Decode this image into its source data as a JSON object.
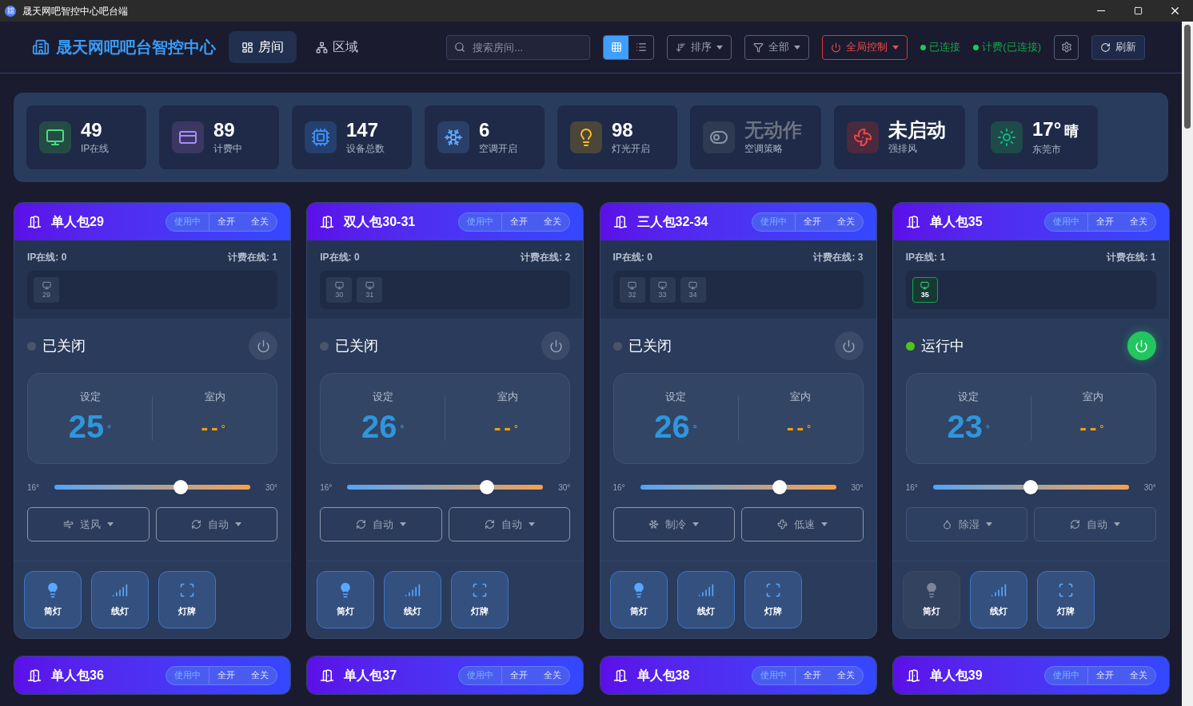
{
  "window": {
    "title": "晟天网吧智控中心吧台端"
  },
  "header": {
    "app_title": "晟天网吧吧台智控中心",
    "tabs": [
      {
        "label": "房间",
        "kind": "grid",
        "selected": true
      },
      {
        "label": "区域",
        "kind": "tree",
        "selected": false
      }
    ],
    "search": {
      "placeholder": "搜索房间..."
    },
    "view_modes": [
      {
        "kind": "grid",
        "selected": true
      },
      {
        "kind": "list",
        "selected": false
      }
    ],
    "sort": "排序",
    "filter": "全部",
    "global_control": "全局控制",
    "connections": [
      {
        "label": "已连接",
        "color": "#22c55e"
      },
      {
        "label": "计费(已连接)",
        "color": "#22c55e"
      }
    ],
    "refresh": "刷新"
  },
  "stats": [
    {
      "kind": "ip",
      "value": "49",
      "label": "IP在线",
      "muted": false
    },
    {
      "kind": "billing",
      "value": "89",
      "label": "计费中",
      "muted": false
    },
    {
      "kind": "chip",
      "value": "147",
      "label": "设备总数",
      "muted": false
    },
    {
      "kind": "snow",
      "value": "6",
      "label": "空调开启",
      "muted": false
    },
    {
      "kind": "bulb",
      "value": "98",
      "label": "灯光开启",
      "muted": false
    },
    {
      "kind": "toggle",
      "value": "无动作",
      "label": "空调策略",
      "muted": true
    },
    {
      "kind": "fan",
      "value": "未启动",
      "label": "强排风",
      "muted": false
    },
    {
      "kind": "sun",
      "value": "17°",
      "extra": "晴",
      "label": "东莞市",
      "muted": false
    }
  ],
  "rooms": [
    {
      "name": "单人包29",
      "status_badge": "使用中",
      "actions": [
        "全开",
        "全关"
      ],
      "ip_online": "IP在线: 0",
      "billing_online": "计费在线: 1",
      "pcs": [
        {
          "number": "29",
          "online": false
        }
      ],
      "ac": {
        "on": false,
        "status": "已关闭",
        "set_label": "设定",
        "set_temp": "25",
        "indoor_label": "室内",
        "indoor_temp": "--",
        "unit": "°",
        "min": "16°",
        "max": "30°",
        "level": 0.643,
        "mode": {
          "label": "送风",
          "kind": "fan"
        },
        "fan": {
          "label": "自动",
          "kind": "auto"
        }
      },
      "lights": [
        {
          "label": "筒灯",
          "kind": "bulb",
          "on": true
        },
        {
          "label": "线灯",
          "kind": "strip",
          "on": true
        },
        {
          "label": "灯牌",
          "kind": "sign",
          "on": true
        }
      ]
    },
    {
      "name": "双人包30-31",
      "status_badge": "使用中",
      "actions": [
        "全开",
        "全关"
      ],
      "ip_online": "IP在线: 0",
      "billing_online": "计费在线: 2",
      "pcs": [
        {
          "number": "30",
          "online": false
        },
        {
          "number": "31",
          "online": false
        }
      ],
      "ac": {
        "on": false,
        "status": "已关闭",
        "set_label": "设定",
        "set_temp": "26",
        "indoor_label": "室内",
        "indoor_temp": "--",
        "unit": "°",
        "min": "16°",
        "max": "30°",
        "level": 0.714,
        "mode": {
          "label": "自动",
          "kind": "auto"
        },
        "fan": {
          "label": "自动",
          "kind": "auto"
        }
      },
      "lights": [
        {
          "label": "筒灯",
          "kind": "bulb",
          "on": true
        },
        {
          "label": "线灯",
          "kind": "strip",
          "on": true
        },
        {
          "label": "灯牌",
          "kind": "sign",
          "on": true
        }
      ]
    },
    {
      "name": "三人包32-34",
      "status_badge": "使用中",
      "actions": [
        "全开",
        "全关"
      ],
      "ip_online": "IP在线: 0",
      "billing_online": "计费在线: 3",
      "pcs": [
        {
          "number": "32",
          "online": false
        },
        {
          "number": "33",
          "online": false
        },
        {
          "number": "34",
          "online": false
        }
      ],
      "ac": {
        "on": false,
        "status": "已关闭",
        "set_label": "设定",
        "set_temp": "26",
        "indoor_label": "室内",
        "indoor_temp": "--",
        "unit": "°",
        "min": "16°",
        "max": "30°",
        "level": 0.714,
        "mode": {
          "label": "制冷",
          "kind": "cool"
        },
        "fan": {
          "label": "低速",
          "kind": "low"
        }
      },
      "lights": [
        {
          "label": "筒灯",
          "kind": "bulb",
          "on": true
        },
        {
          "label": "线灯",
          "kind": "strip",
          "on": true
        },
        {
          "label": "灯牌",
          "kind": "sign",
          "on": true
        }
      ]
    },
    {
      "name": "单人包35",
      "status_badge": "使用中",
      "actions": [
        "全开",
        "全关"
      ],
      "ip_online": "IP在线: 1",
      "billing_online": "计费在线: 1",
      "pcs": [
        {
          "number": "35",
          "online": true
        }
      ],
      "ac": {
        "on": true,
        "status": "运行中",
        "set_label": "设定",
        "set_temp": "23",
        "indoor_label": "室内",
        "indoor_temp": "--",
        "unit": "°",
        "min": "16°",
        "max": "30°",
        "level": 0.5,
        "mode": {
          "label": "除湿",
          "kind": "dry"
        },
        "fan": {
          "label": "自动",
          "kind": "auto"
        }
      },
      "lights": [
        {
          "label": "筒灯",
          "kind": "bulb",
          "on": false
        },
        {
          "label": "线灯",
          "kind": "strip",
          "on": true
        },
        {
          "label": "灯牌",
          "kind": "sign",
          "on": true
        }
      ]
    },
    {
      "name": "单人包36",
      "status_badge": "使用中",
      "actions": [
        "全开",
        "全关"
      ]
    },
    {
      "name": "单人包37",
      "status_badge": "使用中",
      "actions": [
        "全开",
        "全关"
      ]
    },
    {
      "name": "单人包38",
      "status_badge": "使用中",
      "actions": [
        "全开",
        "全关"
      ]
    },
    {
      "name": "单人包39",
      "status_badge": "使用中",
      "actions": [
        "全开",
        "全关"
      ]
    }
  ]
}
